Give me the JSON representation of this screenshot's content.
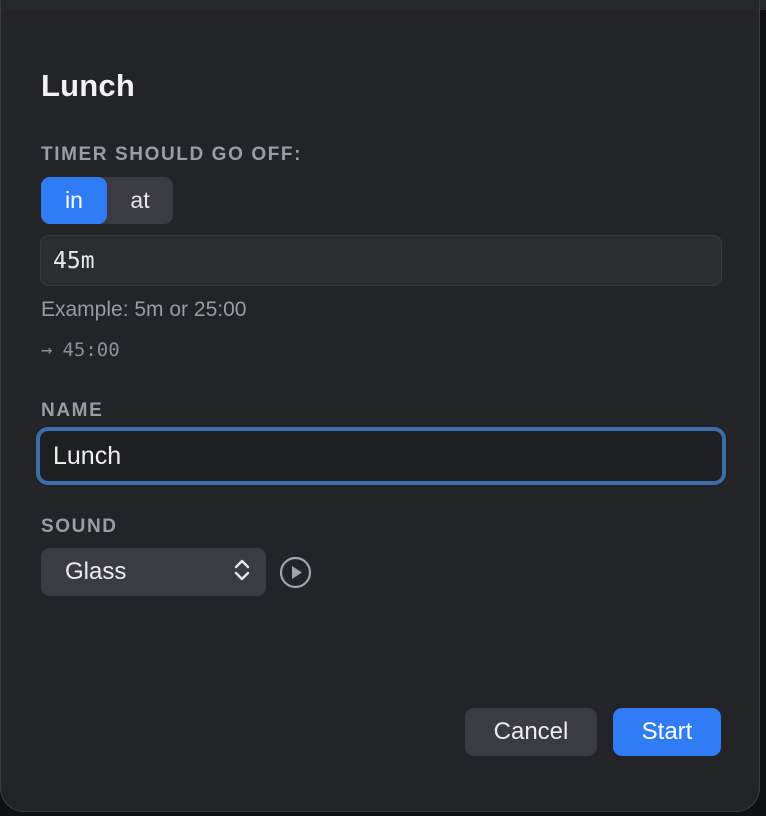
{
  "dialog": {
    "title": "Lunch"
  },
  "timer": {
    "section_label": "TIMER SHOULD GO OFF:",
    "mode_options": [
      "in",
      "at"
    ],
    "selected_mode": "in",
    "duration_value": "45m",
    "example_text": "Example: 5m or 25:00",
    "result_arrow": "→",
    "result_value": "45:00"
  },
  "name": {
    "section_label": "NAME",
    "value": "Lunch"
  },
  "sound": {
    "section_label": "SOUND",
    "selected": "Glass",
    "selector_icon": "chevron-up-down-icon",
    "preview_icon": "play-circle-icon"
  },
  "actions": {
    "cancel_label": "Cancel",
    "start_label": "Start"
  },
  "colors": {
    "accent": "#2f7cf6",
    "focus_ring": "#3c6ea9",
    "dialog_bg": "#232428"
  }
}
